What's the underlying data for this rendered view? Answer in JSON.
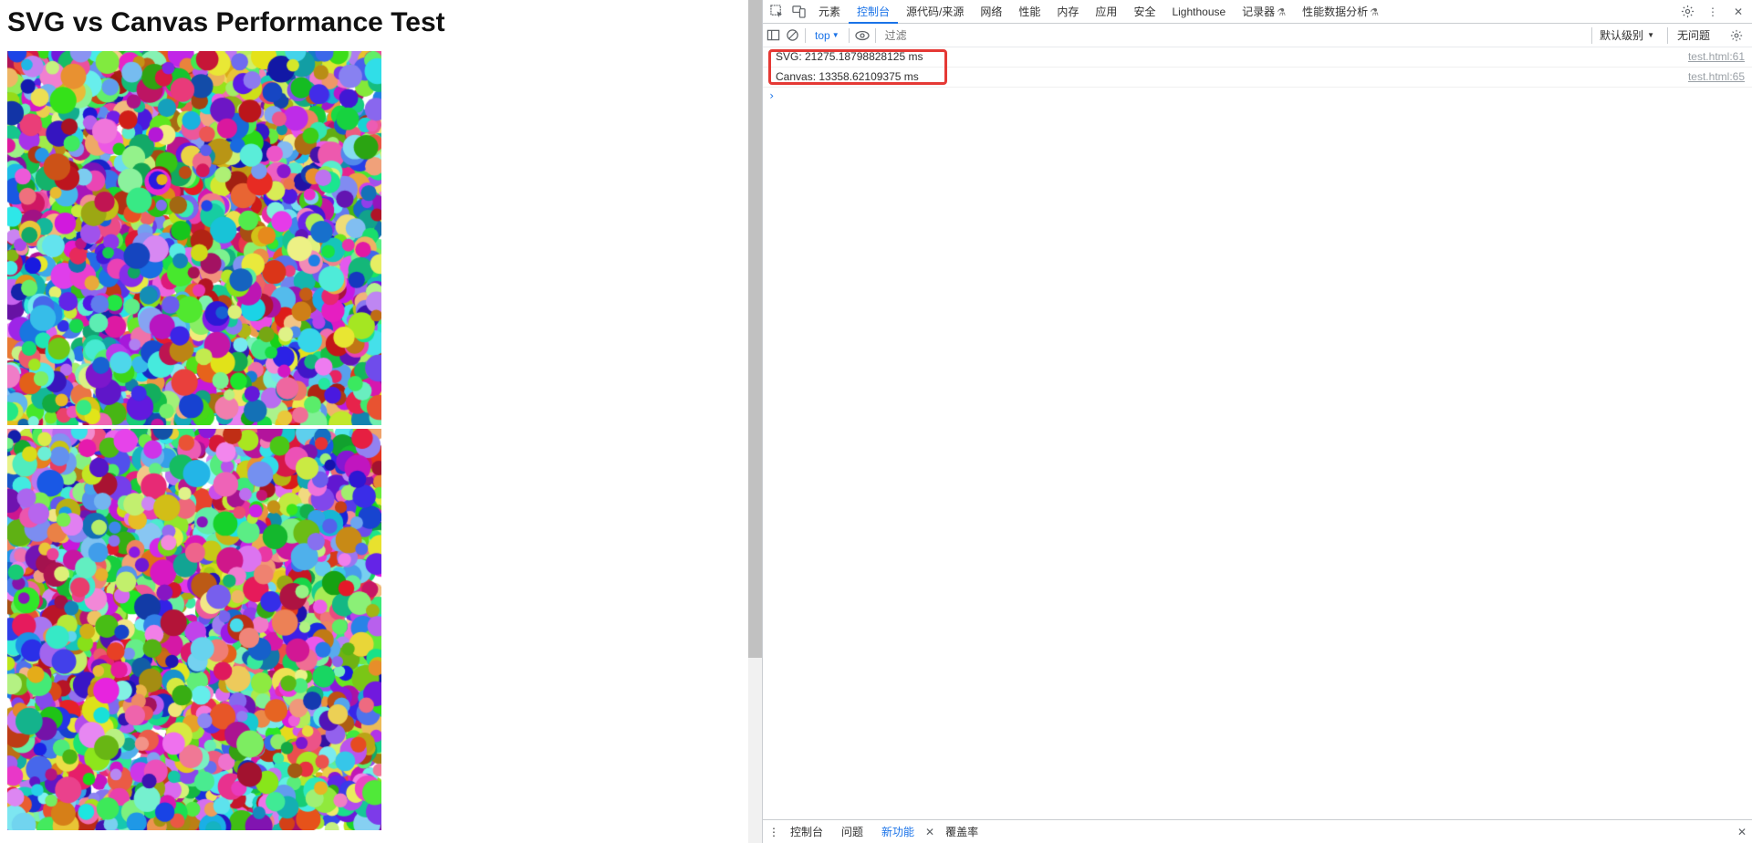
{
  "page": {
    "title": "SVG vs Canvas Performance Test"
  },
  "devtools": {
    "tabs": [
      "元素",
      "控制台",
      "源代码/来源",
      "网络",
      "性能",
      "内存",
      "应用",
      "安全",
      "Lighthouse",
      "记录器",
      "性能数据分析"
    ],
    "context": "top",
    "filter_placeholder": "过滤",
    "levels": "默认级别",
    "no_issues": "无问题"
  },
  "console": {
    "logs": [
      {
        "msg": "SVG: 21275.18798828125 ms",
        "src": "test.html:61"
      },
      {
        "msg": "Canvas: 13358.62109375 ms",
        "src": "test.html:65"
      }
    ]
  },
  "drawer": {
    "tabs": [
      "控制台",
      "问题",
      "新功能",
      "覆盖率"
    ]
  }
}
